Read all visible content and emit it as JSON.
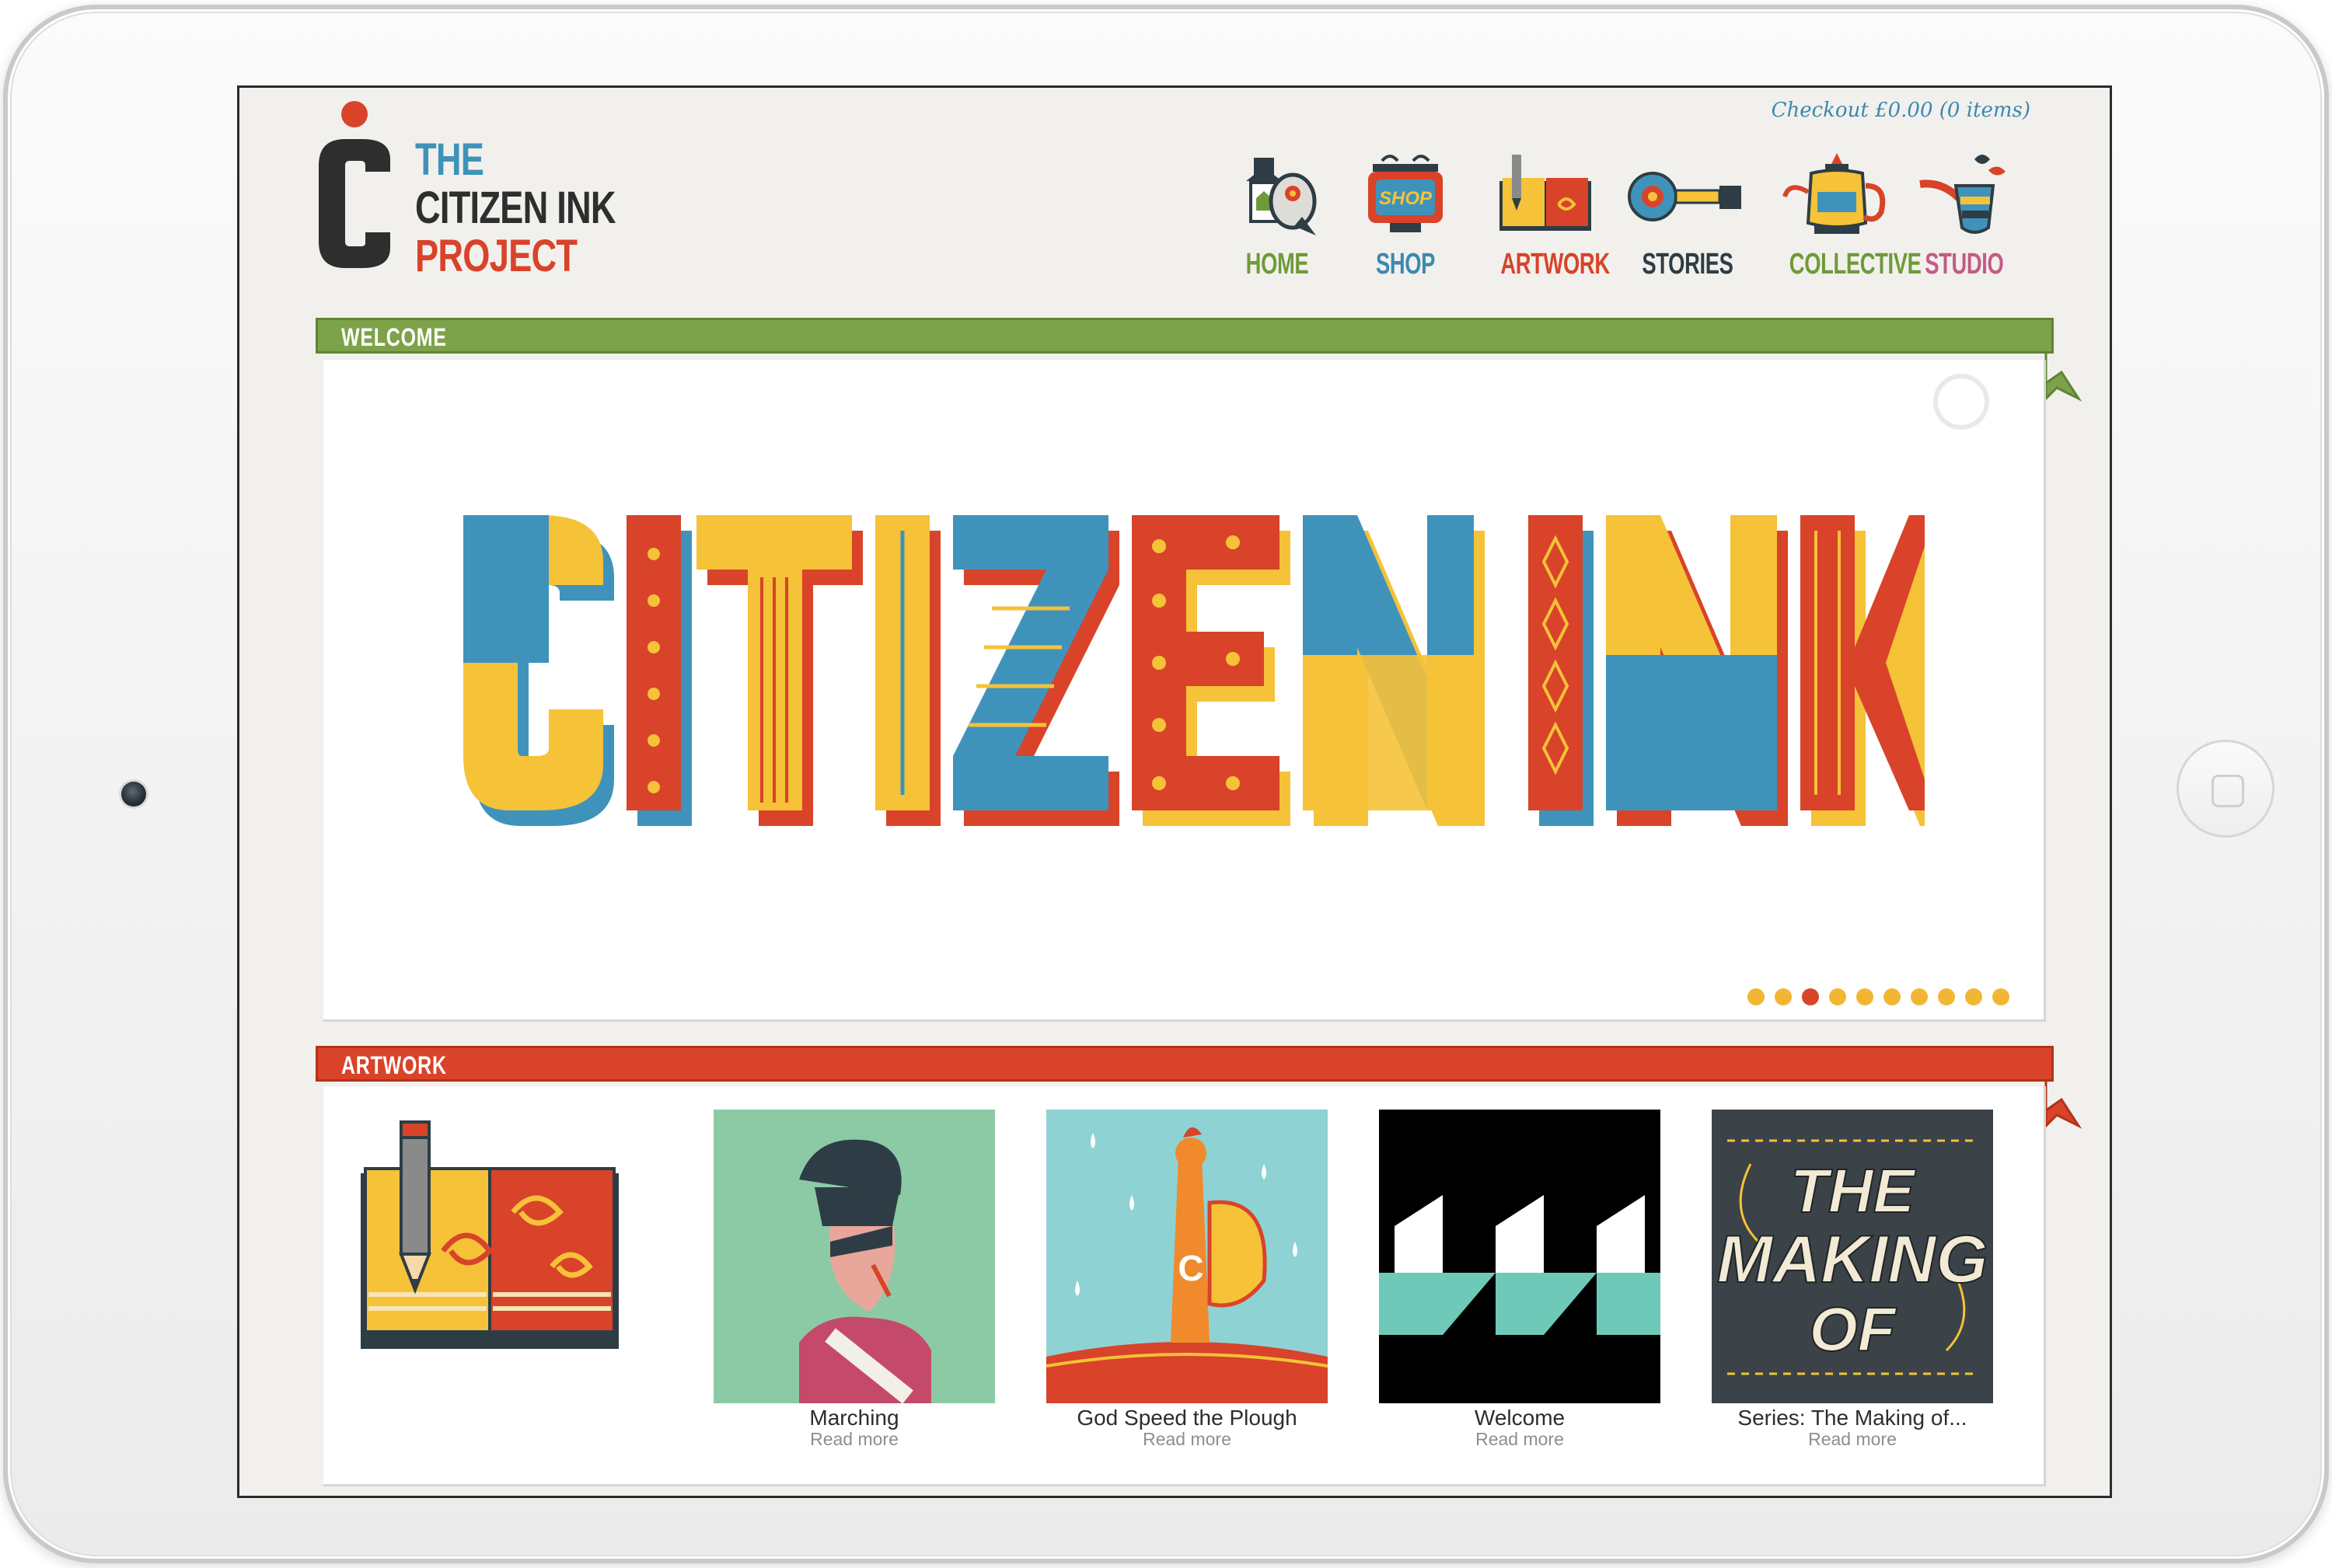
{
  "header": {
    "checkout": "Checkout £0.00 (0 items)",
    "logo": {
      "line1": "THE",
      "line2": "CITIZEN INK",
      "line3": "PROJECT",
      "mark_icon": "c-logo-icon"
    }
  },
  "nav": [
    {
      "label": "HOME",
      "icon": "bird-house-icon",
      "color": "#6f9a3a"
    },
    {
      "label": "SHOP",
      "icon": "shop-sign-icon",
      "color": "#3a8ab0"
    },
    {
      "label": "ARTWORK",
      "icon": "pencil-book-icon",
      "color": "#d8432a"
    },
    {
      "label": "STORIES",
      "icon": "key-icon",
      "color": "#2e3d45"
    },
    {
      "label": "COLLECTIVE",
      "icon": "teapot-icon",
      "color": "#6f9a3a"
    },
    {
      "label": "STUDIO",
      "icon": "pipe-icon",
      "color": "#c35a86"
    }
  ],
  "sections": {
    "welcome": {
      "label": "WELCOME",
      "color": "#7ea24a"
    },
    "artwork": {
      "label": "ARTWORK",
      "color": "#d8432a"
    }
  },
  "hero": {
    "title": "CITIZEN INK",
    "slide_count": 10,
    "active_slide": 3
  },
  "artwork_items": [
    {
      "title": "Marching",
      "more": "Read more"
    },
    {
      "title": "God Speed the Plough",
      "more": "Read more"
    },
    {
      "title": "Welcome",
      "more": "Read more"
    },
    {
      "title": "Series: The Making of...",
      "more": "Read more",
      "thumb_text": [
        "THE",
        "MAKING",
        "OF"
      ]
    }
  ],
  "colors": {
    "blue": "#3f93bb",
    "yellow": "#f5c238",
    "red": "#d8432a",
    "green": "#7ea24a",
    "dark": "#2b2b2b",
    "cream": "#f2f0ec"
  }
}
